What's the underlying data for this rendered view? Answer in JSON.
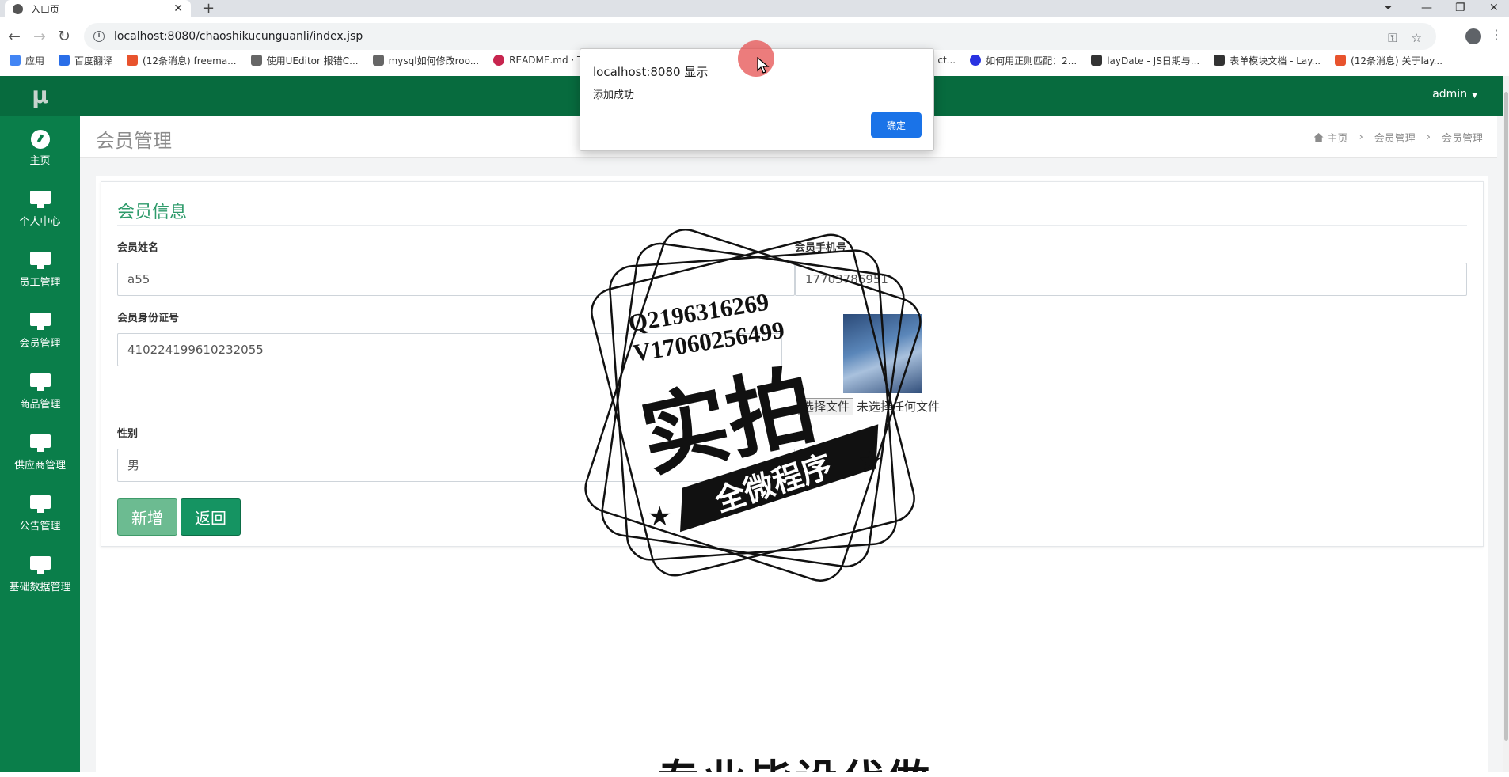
{
  "browser": {
    "tab_title": "入口页",
    "url": "localhost:8080/chaoshikucunguanli/index.jsp",
    "bookmarks": [
      "应用",
      "百度翻译",
      "(12条消息) freema...",
      "使用UEditor 报错C...",
      "mysql如何修改roo...",
      "README.md · T",
      "ct...",
      "如何用正则匹配：2...",
      "layDate - JS日期与...",
      "表单模块文档 - Lay...",
      "(12条消息) 关于lay..."
    ]
  },
  "app": {
    "logo": "μ",
    "user": "admin",
    "sidebar": [
      {
        "label": "主页",
        "icon": "dashboard-icon"
      },
      {
        "label": "个人中心",
        "icon": "monitor-icon"
      },
      {
        "label": "员工管理",
        "icon": "monitor-icon"
      },
      {
        "label": "会员管理",
        "icon": "monitor-icon"
      },
      {
        "label": "商品管理",
        "icon": "monitor-icon"
      },
      {
        "label": "供应商管理",
        "icon": "monitor-icon"
      },
      {
        "label": "公告管理",
        "icon": "monitor-icon"
      },
      {
        "label": "基础数据管理",
        "icon": "monitor-icon"
      }
    ],
    "page_title": "会员管理",
    "breadcrumb": [
      "主页",
      "会员管理",
      "会员管理"
    ]
  },
  "form": {
    "title": "会员信息",
    "name_label": "会员姓名",
    "name_value": "a55",
    "phone_label": "会员手机号",
    "phone_value": "17703786951",
    "idcard_label": "会员身份证号",
    "idcard_value": "410224199610232055",
    "file_button": "选择文件",
    "file_status": "未选择任何文件",
    "gender_label": "性别",
    "gender_value": "男",
    "add_button": "新增",
    "back_button": "返回"
  },
  "dialog": {
    "title": "localhost:8080 显示",
    "message": "添加成功",
    "ok": "确定"
  },
  "watermark": {
    "line1": "Q2196316269",
    "line2": "V17060256499",
    "main": "实拍",
    "banner": "全微程序",
    "bottom_text": "专业毕设代做"
  },
  "colors": {
    "sidebar": "#0a7e4a",
    "topbar": "#076b3e",
    "accent": "#2e9b6b",
    "dialog_button": "#1a73e8"
  }
}
